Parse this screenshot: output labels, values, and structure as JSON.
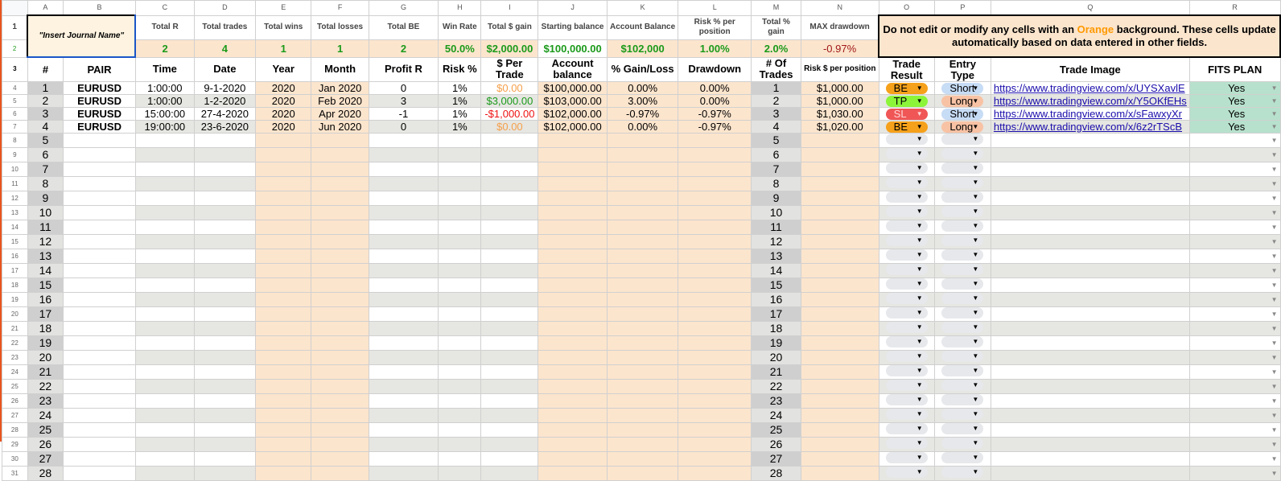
{
  "columns": [
    "A",
    "B",
    "C",
    "D",
    "E",
    "F",
    "G",
    "H",
    "I",
    "J",
    "K",
    "L",
    "M",
    "N",
    "O",
    "P",
    "Q",
    "R"
  ],
  "journal_name": "\"Insert Journal Name\"",
  "summary_labels": [
    "Total R",
    "Total trades",
    "Total wins",
    "Total losses",
    "Total BE",
    "Win Rate",
    "Total $ gain",
    "Starting balance",
    "Account Balance",
    "Risk % per position",
    "Total % gain",
    "MAX drawdown"
  ],
  "summary_values": [
    "2",
    "4",
    "1",
    "1",
    "2",
    "50.0%",
    "$2,000.00",
    "$100,000.00",
    "$102,000",
    "1.00%",
    "2.0%",
    "-0.97%"
  ],
  "note": {
    "before": "Do not edit or modify any cells with an ",
    "highlight": "Orange",
    "after": " background. These cells update automatically based on data entered in other fields."
  },
  "headers": [
    "#",
    "PAIR",
    "Time",
    "Date",
    "Year",
    "Month",
    "Profit R",
    "Risk %",
    "$ Per Trade",
    "Account balance",
    "% Gain/Loss",
    "Drawdown",
    "# Of Trades",
    "Risk $ per position",
    "Trade Result",
    "Entry Type",
    "Trade Image",
    "FITS PLAN"
  ],
  "trades": [
    {
      "pair": "EURUSD",
      "time": "1:00:00",
      "date": "9-1-2020",
      "year": "2020",
      "month": "Jan 2020",
      "profit_r": "0",
      "risk": "1%",
      "per_trade": "$0.00",
      "balance": "$100,000.00",
      "gain": "0.00%",
      "drawdown": "0.00%",
      "risk_usd": "$1,000.00",
      "result": "BE",
      "entry": "Short",
      "image": "https://www.tradingview.com/x/UYSXavlE",
      "fits": "Yes"
    },
    {
      "pair": "EURUSD",
      "time": "1:00:00",
      "date": "1-2-2020",
      "year": "2020",
      "month": "Feb 2020",
      "profit_r": "3",
      "risk": "1%",
      "per_trade": "$3,000.00",
      "balance": "$103,000.00",
      "gain": "3.00%",
      "drawdown": "0.00%",
      "risk_usd": "$1,000.00",
      "result": "TP",
      "entry": "Long",
      "image": "https://www.tradingview.com/x/Y5OKfEHs",
      "fits": "Yes"
    },
    {
      "pair": "EURUSD",
      "time": "15:00:00",
      "date": "27-4-2020",
      "year": "2020",
      "month": "Apr 2020",
      "profit_r": "-1",
      "risk": "1%",
      "per_trade": "-$1,000.00",
      "balance": "$102,000.00",
      "gain": "-0.97%",
      "drawdown": "-0.97%",
      "risk_usd": "$1,030.00",
      "result": "SL",
      "entry": "Short",
      "image": "https://www.tradingview.com/x/sFawxyXr",
      "fits": "Yes"
    },
    {
      "pair": "EURUSD",
      "time": "19:00:00",
      "date": "23-6-2020",
      "year": "2020",
      "month": "Jun 2020",
      "profit_r": "0",
      "risk": "1%",
      "per_trade": "$0.00",
      "balance": "$102,000.00",
      "gain": "0.00%",
      "drawdown": "-0.97%",
      "risk_usd": "$1,020.00",
      "result": "BE",
      "entry": "Long",
      "image": "https://www.tradingview.com/x/6z2rTScB",
      "fits": "Yes"
    }
  ],
  "row_numbers": [
    "1",
    "2",
    "3",
    "4",
    "5",
    "6",
    "7",
    "8",
    "9",
    "10",
    "11",
    "12",
    "13",
    "14",
    "15",
    "16",
    "17",
    "18",
    "19",
    "20",
    "21",
    "22",
    "23",
    "24",
    "25",
    "26",
    "27",
    "28",
    "29",
    "30",
    "31"
  ],
  "trade_numbers": [
    "1",
    "2",
    "3",
    "4",
    "5",
    "6",
    "7",
    "8",
    "9",
    "10",
    "11",
    "12",
    "13",
    "14",
    "15",
    "16",
    "17",
    "18",
    "19",
    "20",
    "21",
    "22",
    "23",
    "24",
    "25",
    "26",
    "27",
    "28"
  ],
  "colors": {
    "BE": "#f6a11b",
    "TP": "#8cf53a",
    "SL": "#f05656",
    "Short": "#c7dcf5",
    "Long": "#f8c2a4",
    "empty": "#e6e8eb",
    "gain": "#1a9a1a",
    "loss": "#ee1111",
    "zero": "#f5a04a",
    "maxdd": "#a01818"
  }
}
